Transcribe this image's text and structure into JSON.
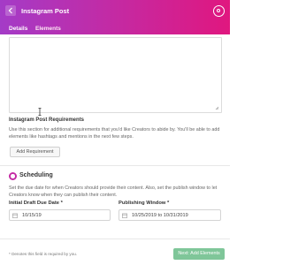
{
  "header": {
    "title": "Instagram Post",
    "back_icon": "back-arrow-icon",
    "platform_icon": "instagram-icon",
    "gradient": [
      "#a43bc7",
      "#e0177f"
    ]
  },
  "tabs": [
    {
      "label": "Details",
      "active": true
    },
    {
      "label": "Elements",
      "active": false
    }
  ],
  "requirements": {
    "label": "Instagram Post Requirements",
    "help": "Use this section for additional requirements that you'd like Creators to abide by. You'll be able to add elements like hashtags and mentions in the next few steps.",
    "button": "Add Requirement"
  },
  "scheduling": {
    "title": "Scheduling",
    "help": "Set the due date for when Creators should provide their content. Also, set the publish window to let Creators know when they can publish their content.",
    "draft_label": "Initial Draft Due Date *",
    "draft_value": "10/15/19",
    "publish_label": "Publishing Window *",
    "publish_value": "10/25/2019 to 10/31/2019"
  },
  "footer": {
    "note": "* Denotes this field is required by you.",
    "next_button": "Next: Add Elements",
    "next_color": "#7fc699"
  }
}
